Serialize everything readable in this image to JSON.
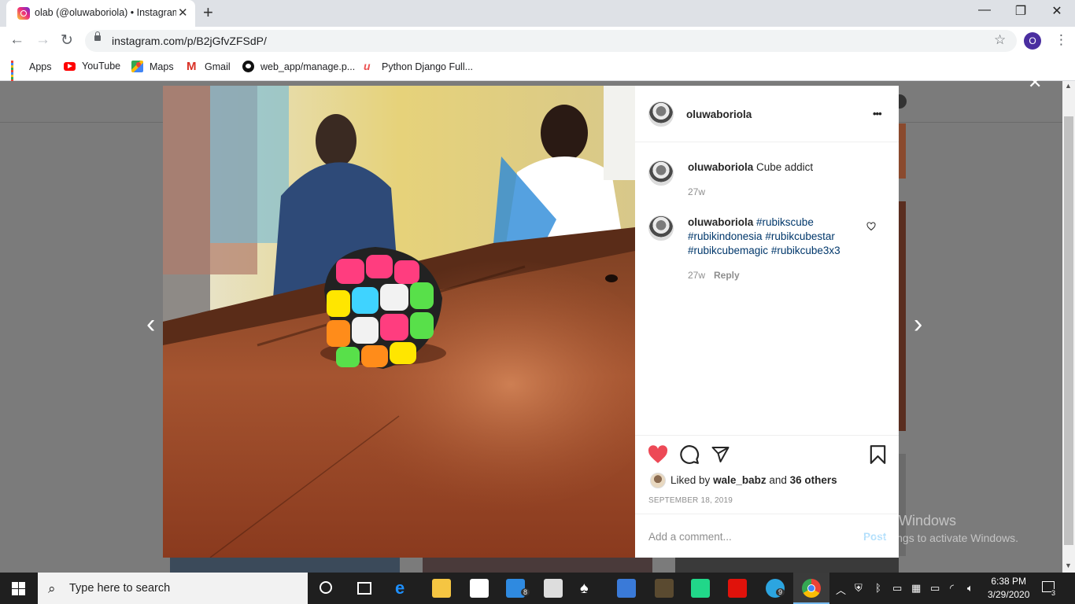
{
  "browser": {
    "tab_title": "olab (@oluwaboriola) • Instagram",
    "tab_close": "✕",
    "new_tab": "+",
    "url": "instagram.com/p/B2jGfvZFSdP/",
    "profile_initial": "O",
    "window_controls": {
      "minimize": "—",
      "maximize": "❐",
      "close": "✕"
    }
  },
  "bookmarks": [
    {
      "label": "Apps",
      "icon": "apps-grid-icon"
    },
    {
      "label": "YouTube",
      "icon": "youtube-icon"
    },
    {
      "label": "Maps",
      "icon": "maps-icon"
    },
    {
      "label": "Gmail",
      "icon": "gmail-icon"
    },
    {
      "label": "web_app/manage.p...",
      "icon": "github-icon"
    },
    {
      "label": "Python Django Full...",
      "icon": "udemy-icon"
    }
  ],
  "post": {
    "author": "oluwaboriola",
    "more_label": "•••",
    "comments": [
      {
        "user": "oluwaboriola",
        "text": "Cube addict",
        "age": "27w"
      },
      {
        "user": "oluwaboriola",
        "tags": [
          "#rubikscube",
          "#rubikindonesia",
          "#rubikcubestar",
          "#rubikcubemagic",
          "#rubikcube3x3"
        ],
        "age": "27w",
        "reply": "Reply"
      }
    ],
    "liked_by_prefix": "Liked by",
    "liked_by_user": "wale_babz",
    "liked_by_and": "and",
    "liked_by_others": "36 others",
    "date": "SEPTEMBER 18, 2019",
    "comment_placeholder": "Add a comment...",
    "post_button": "Post",
    "modal_close": "✕"
  },
  "watermark": {
    "line1": "Activate Windows",
    "line2": "Go to Settings to activate Windows."
  },
  "taskbar": {
    "search_placeholder": "Type here to search",
    "mail_badge": "8",
    "telegram_badge": "9",
    "time": "6:38 PM",
    "date": "3/29/2020",
    "notification_count": "3"
  },
  "colors": {
    "like_red": "#ed4956",
    "hashtag_blue": "#00376b",
    "taskbar": "#1f1f1f"
  }
}
